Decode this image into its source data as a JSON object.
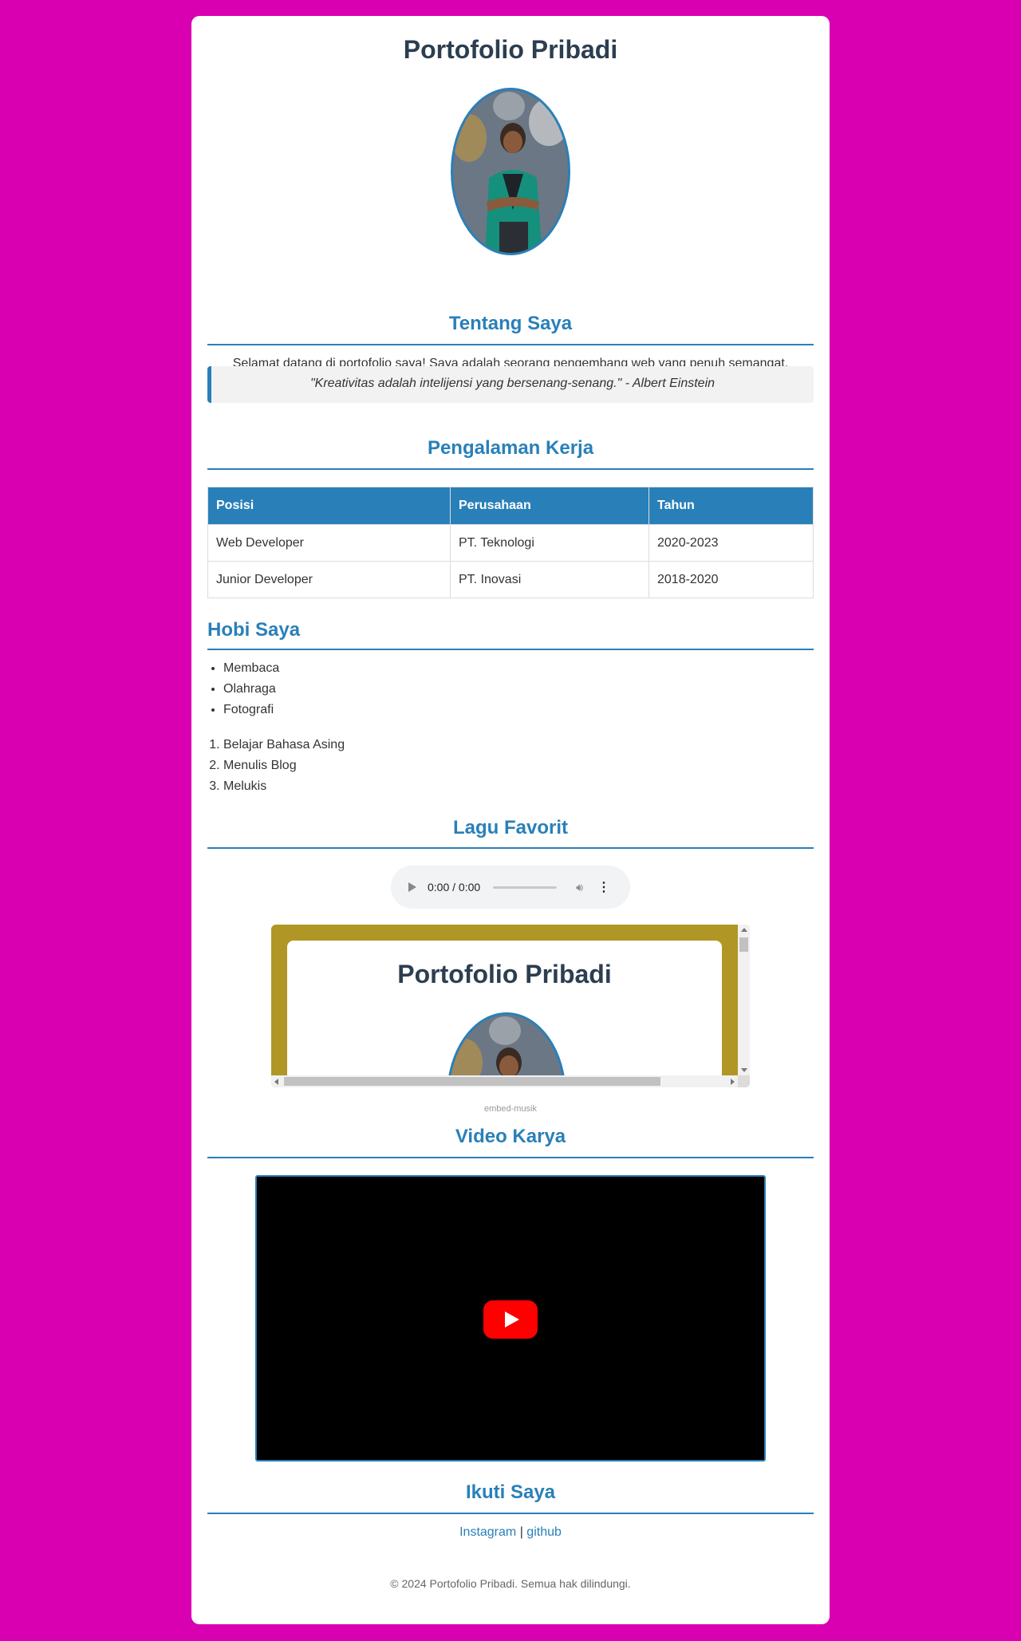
{
  "header": {
    "title": "Portofolio Pribadi"
  },
  "about": {
    "title": "Tentang Saya",
    "intro": "Selamat datang di portofolio saya! Saya adalah seorang pengembang web yang penuh semangat.",
    "quote": "\"Kreativitas adalah intelijensi yang bersenang-senang.\" - Albert Einstein"
  },
  "experience": {
    "title": "Pengalaman Kerja",
    "columns": [
      "Posisi",
      "Perusahaan",
      "Tahun"
    ],
    "rows": [
      [
        "Web Developer",
        "PT. Teknologi",
        "2020-2023"
      ],
      [
        "Junior Developer",
        "PT. Inovasi",
        "2018-2020"
      ]
    ]
  },
  "hobbies": {
    "title": "Hobi Saya",
    "unordered": [
      "Membaca",
      "Olahraga",
      "Fotografi"
    ],
    "ordered": [
      "Belajar Bahasa Asing",
      "Menulis Blog",
      "Melukis"
    ]
  },
  "music": {
    "title": "Lagu Favorit",
    "audio_time": "0:00 / 0:00",
    "embed_title": "Portofolio Pribadi",
    "caption": "embed-musik"
  },
  "video": {
    "title": "Video Karya"
  },
  "social": {
    "title": "Ikuti Saya",
    "instagram": "Instagram",
    "separator": "|",
    "github": "github"
  },
  "footer": {
    "text": "© 2024 Portofolio Pribadi. Semua hak dilindungi."
  },
  "colors": {
    "background": "#d900b1",
    "accent": "#2980b9",
    "heading": "#2c3e50",
    "embed_bg": "#b09624"
  }
}
